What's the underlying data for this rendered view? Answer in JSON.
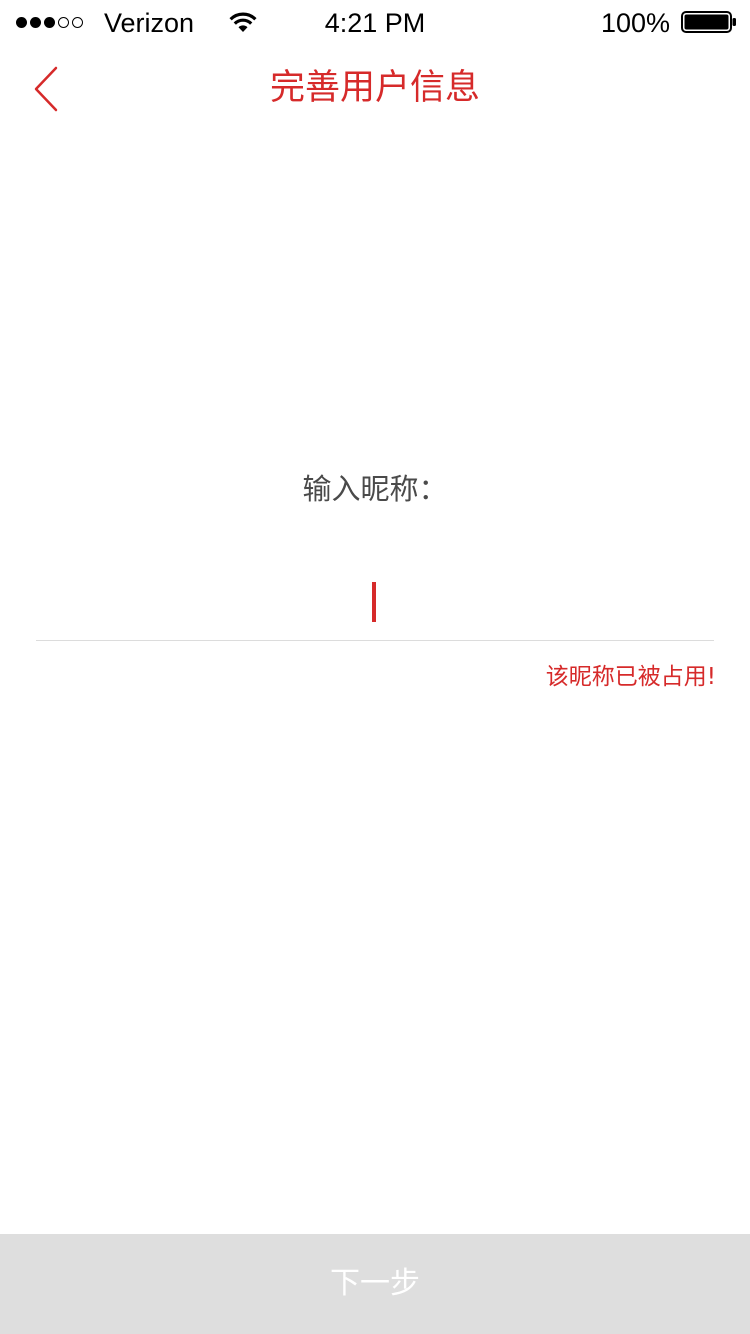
{
  "status_bar": {
    "carrier": "Verizon",
    "time": "4:21 PM",
    "battery_percent": "100%",
    "signal_strength": 3,
    "signal_max": 5,
    "wifi_icon": "wifi-icon",
    "battery_icon": "battery-icon",
    "battery_level": 1.0
  },
  "nav": {
    "title": "完善用户信息",
    "back_icon": "chevron-left-icon"
  },
  "form": {
    "label": "输入昵称：",
    "nickname_value": "",
    "nickname_placeholder": "",
    "error_message": "该昵称已被占用!"
  },
  "footer": {
    "next_label": "下一步"
  },
  "colors": {
    "accent": "#d62a2a",
    "button_disabled_bg": "#dedede",
    "divider": "#dcdcdc"
  }
}
